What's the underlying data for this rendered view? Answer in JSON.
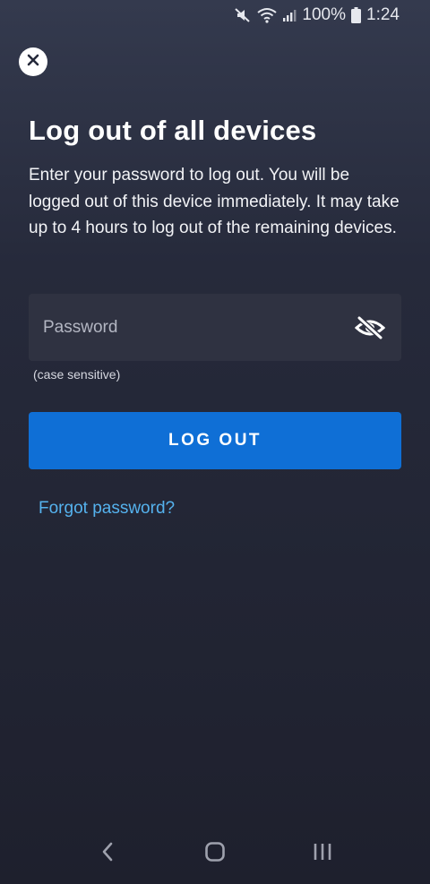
{
  "status_bar": {
    "battery": "100%",
    "time": "1:24"
  },
  "header": {
    "title": "Log out of all devices",
    "description": "Enter your password to log out. You will be logged out of this device immediately. It may take up to 4 hours to log out of the remaining devices."
  },
  "form": {
    "password_placeholder": "Password",
    "password_value": "",
    "hint": "(case sensitive)",
    "logout_label": "LOG OUT",
    "forgot_label": "Forgot password?"
  },
  "icons": {
    "close": "close-icon",
    "visibility": "eye-off-icon",
    "nav_back": "back-icon",
    "nav_home": "home-icon",
    "nav_recents": "recents-icon"
  },
  "colors": {
    "primary_button": "#0f6fd6",
    "link": "#55b2ee",
    "field_background": "#2f3241"
  }
}
